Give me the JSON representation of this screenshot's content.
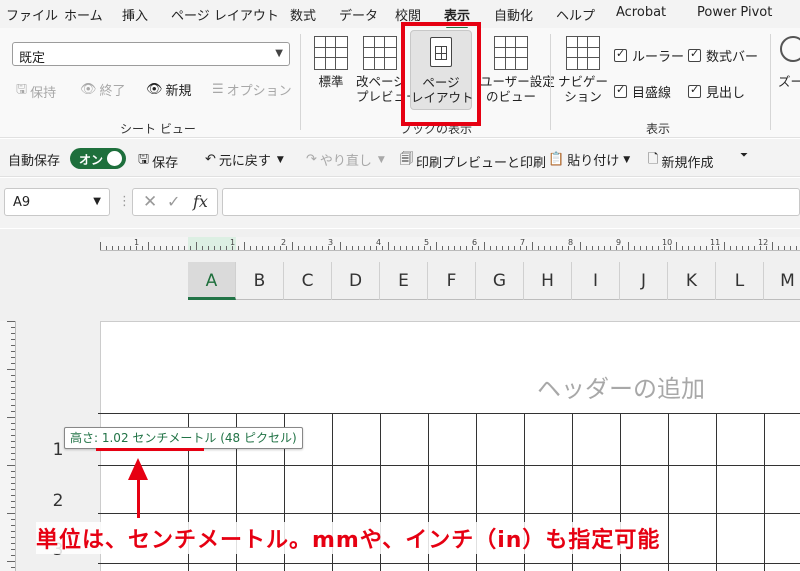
{
  "tabs": [
    {
      "label": "ファイル",
      "active": false
    },
    {
      "label": "ホーム",
      "active": false
    },
    {
      "label": "挿入",
      "active": false
    },
    {
      "label": "ページ レイアウト",
      "active": false
    },
    {
      "label": "数式",
      "active": false
    },
    {
      "label": "データ",
      "active": false
    },
    {
      "label": "校閲",
      "active": false
    },
    {
      "label": "表示",
      "active": true
    },
    {
      "label": "自動化",
      "active": false
    },
    {
      "label": "ヘルプ",
      "active": false
    },
    {
      "label": "Acrobat",
      "active": false
    },
    {
      "label": "Power Pivot",
      "active": false
    }
  ],
  "sheet_view": {
    "select_value": "既定",
    "keep": "保持",
    "exit": "終了",
    "new": "新規",
    "options": "オプション",
    "group_label": "シート ビュー"
  },
  "workbook_views": {
    "normal": "標準",
    "page_break_1": "改ページ",
    "page_break_2": "プレビュー",
    "page_layout_1": "ページ",
    "page_layout_2": "レイアウト",
    "custom_1": "ユーザー設定",
    "custom_2": "のビュー",
    "group_label": "ブックの表示"
  },
  "show": {
    "navigation_1": "ナビゲー",
    "navigation_2": "ション",
    "ruler": "ルーラー",
    "formula_bar": "数式バー",
    "gridlines": "目盛線",
    "headings": "見出し",
    "group_label": "表示",
    "zoom_partial": "ズー"
  },
  "qat": {
    "autosave": "自動保存",
    "toggle": "オン",
    "save": "保存",
    "undo": "元に戻す",
    "redo": "やり直し",
    "print_preview": "印刷プレビューと印刷",
    "paste": "貼り付け",
    "new_doc": "新規作成"
  },
  "formula_bar": {
    "name_box": "A9",
    "fx": "fx",
    "value": ""
  },
  "ruler_numbers": [
    "1",
    "1",
    "2",
    "3",
    "4",
    "5",
    "6",
    "7",
    "8",
    "9",
    "10",
    "11",
    "12"
  ],
  "columns": [
    "A",
    "B",
    "C",
    "D",
    "E",
    "F",
    "G",
    "H",
    "I",
    "J",
    "K",
    "L",
    "M"
  ],
  "rows": [
    "1",
    "2",
    "3"
  ],
  "page_header_placeholder": "ヘッダーの追加",
  "tooltip": "高さ: 1.02 センチメートル (48 ピクセル)",
  "annotation": "単位は、センチメートル。mmや、インチ（in）も指定可能",
  "colors": {
    "accent_green": "#217346",
    "annotation_red": "#e60012"
  }
}
